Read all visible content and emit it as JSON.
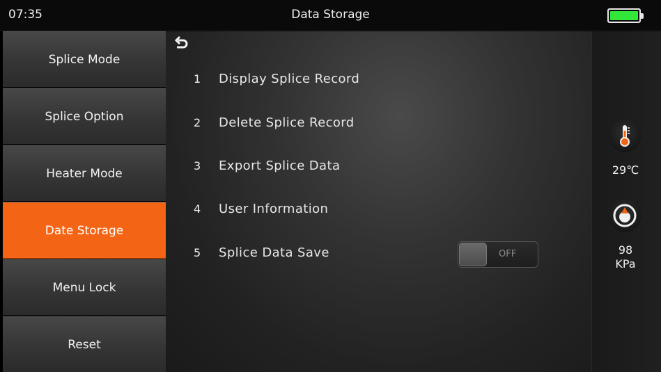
{
  "status": {
    "time": "07:35",
    "title": "Data Storage",
    "battery_icon": "battery-full-icon",
    "battery_color": "#33e63a"
  },
  "sidebar": {
    "items": [
      {
        "label": "Splice Mode",
        "active": false
      },
      {
        "label": "Splice Option",
        "active": false
      },
      {
        "label": "Heater Mode",
        "active": false
      },
      {
        "label": "Date Storage",
        "active": true
      },
      {
        "label": "Menu Lock",
        "active": false
      },
      {
        "label": "Reset",
        "active": false
      }
    ],
    "active_color": "#f36415"
  },
  "main": {
    "back_icon": "back-arrow-icon",
    "options": [
      {
        "num": "1",
        "label": "Display Splice Record"
      },
      {
        "num": "2",
        "label": "Delete Splice Record"
      },
      {
        "num": "3",
        "label": "Export Splice Data"
      },
      {
        "num": "4",
        "label": "User Information"
      },
      {
        "num": "5",
        "label": "Splice Data Save"
      }
    ],
    "toggle": {
      "state": "OFF"
    }
  },
  "readings": {
    "temperature": "29℃",
    "temperature_icon": "thermometer-icon",
    "pressure_value": "98",
    "pressure_unit": "KPa",
    "pressure_icon": "pressure-gauge-icon"
  }
}
